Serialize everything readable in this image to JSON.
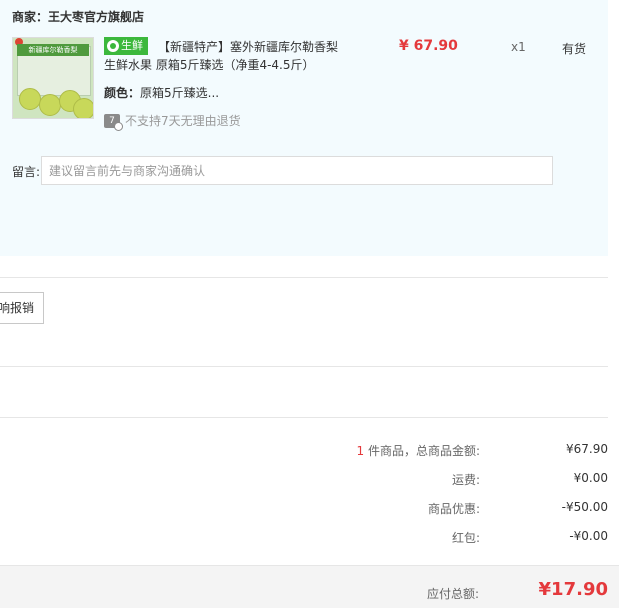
{
  "shop": {
    "label": "商家：",
    "name": "王大枣官方旗舰店"
  },
  "product": {
    "tag_label": "生鲜",
    "title_line1": "【新疆特产】塞外新疆库尔勒香梨",
    "title_line2": "生鲜水果 原箱5斤臻选（净重4-4.5斤）",
    "color_label": "颜色：",
    "color_value": "原箱5斤臻选...",
    "return_icon_text": "7",
    "return_note": "不支持7天无理由退货",
    "price": "¥ 67.90",
    "quantity": "x1",
    "stock": "有货",
    "image_text": "新疆库尔勒香梨"
  },
  "message": {
    "label": "留言:",
    "placeholder": "建议留言前先与商家沟通确认"
  },
  "invoice": {
    "button_label": "响报销"
  },
  "summary": {
    "count": "1",
    "count_suffix": " 件商品，总商品金额:",
    "goods_total": "¥67.90",
    "shipping_label": "运费:",
    "shipping_value": "¥0.00",
    "discount_label": "商品优惠:",
    "discount_value": "-¥50.00",
    "redpacket_label": "红包:",
    "redpacket_value": "-¥0.00"
  },
  "total": {
    "label": "应付总额:",
    "value": "¥17.90"
  },
  "colors": {
    "accent_red": "#e4393c",
    "fresh_green": "#3cb83c",
    "panel_bg": "#f3fbfe"
  }
}
